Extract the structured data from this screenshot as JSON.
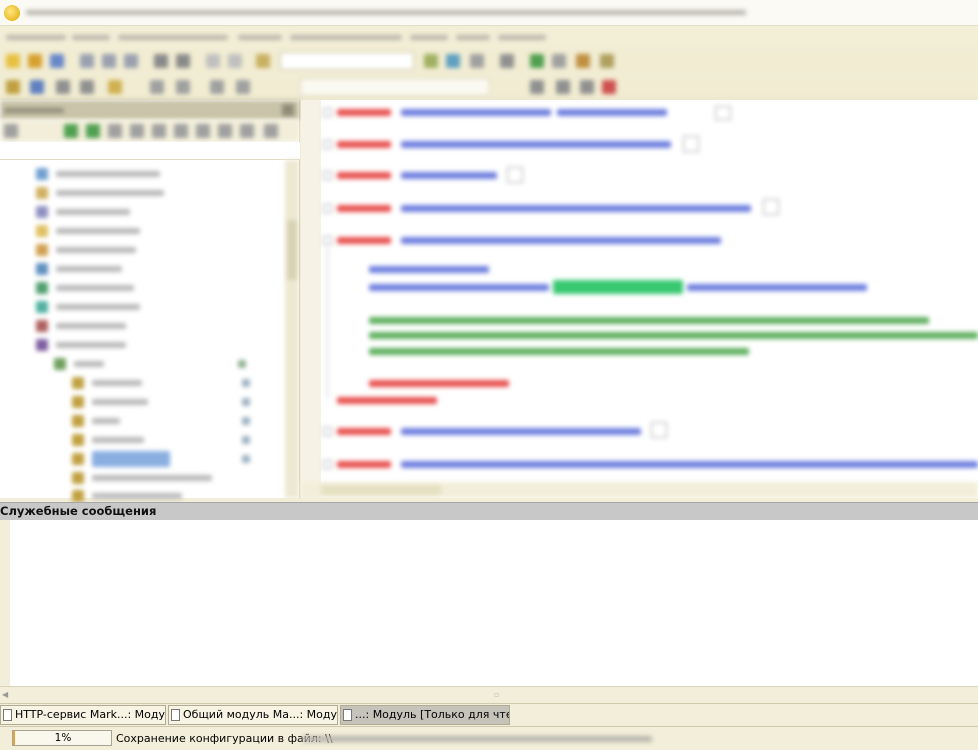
{
  "messages_panel": {
    "title": "Служебные сообщения"
  },
  "window_tabs": [
    {
      "label": "HTTP-сервис Mark...: Модуль"
    },
    {
      "label": "Общий модуль Ма...: Модуль"
    },
    {
      "label": "...: Модуль [Только для чте..."
    }
  ],
  "status": {
    "progress_value": 0.01,
    "progress_text": "1%",
    "text": "Сохранение конфигурации в файл: \\\\"
  },
  "colors": {
    "accent_selection": "#8aaee0",
    "progress": "#e8a33a",
    "keyword": "#e0303a",
    "identifier": "#4b5bd0",
    "comment": "#3e9a3e",
    "highlight": "#38c870"
  }
}
